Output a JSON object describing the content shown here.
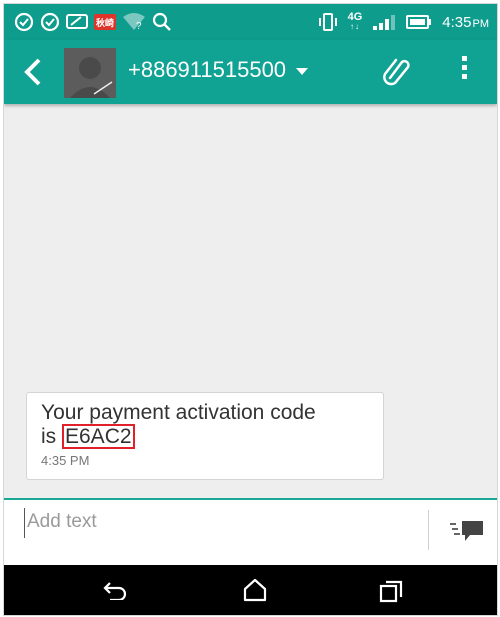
{
  "status_bar": {
    "time": "4:35",
    "ampm": "PM",
    "network_badge": "4G",
    "notification_badge": "秋崎"
  },
  "header": {
    "contact": "+886911515500",
    "icons": [
      "back-arrow-icon",
      "avatar",
      "dropdown-caret-icon",
      "attach-icon",
      "more-vert-icon"
    ],
    "accent": "#10a293"
  },
  "conversation": {
    "message_prefix_line1": "Your payment activation code",
    "message_prefix_line2": "is ",
    "code": "E6AC2",
    "time": "4:35 PM",
    "highlight_color": "#e0202a"
  },
  "compose": {
    "placeholder": "Add text"
  },
  "nav_bar": {
    "icons": [
      "nav-back-icon",
      "nav-home-icon",
      "nav-recent-apps-icon"
    ]
  }
}
